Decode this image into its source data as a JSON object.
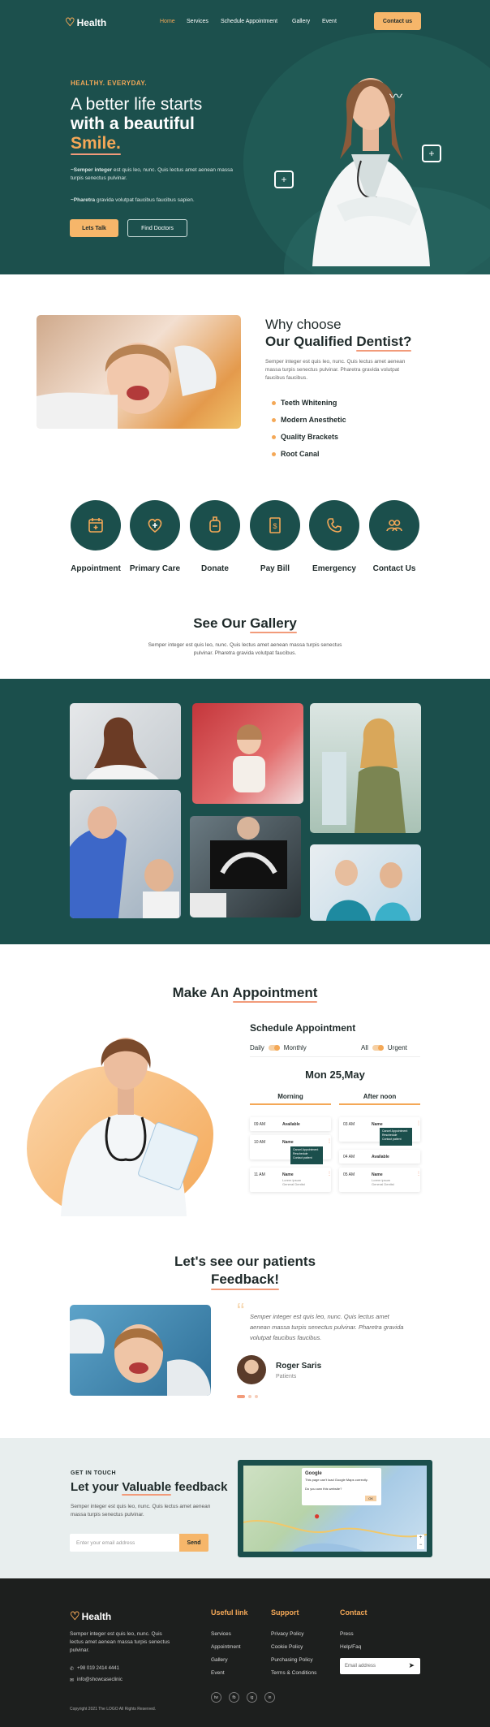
{
  "brand": {
    "name": "Health",
    "mark": "♡"
  },
  "nav": {
    "items": [
      "Home",
      "Services",
      "Schedule Appointment",
      "Gallery",
      "Event"
    ],
    "contact_label": "Contact us"
  },
  "hero": {
    "tagline": "HEALTHY. EVERYDAY.",
    "title_line1": "A better life starts",
    "title_line2": "with a beautiful",
    "title_highlight": "Smile.",
    "p1_bold": "~Semper integer",
    "p1": " est quis leo, nunc. Quis lectus amet aenean massa turpis senectus pulvinar.",
    "p2_bold": "~Pharetra",
    "p2": " gravida volutpat faucibus faucibus sapien.",
    "btn_primary": "Lets Talk",
    "btn_secondary": "Find Doctors"
  },
  "why": {
    "title_line1": "Why choose",
    "title_prefix": "Our Qualified ",
    "title_highlight": "Dentist?",
    "body": "Semper integer est quis leo, nunc. Quis lectus amet aenean massa turpis senectus pulvinar. Pharetra gravida volutpat faucibus faucibus.",
    "bullets": [
      "Teeth Whitening",
      "Modern Anesthetic",
      "Quality Brackets",
      "Root Canal"
    ]
  },
  "services": [
    "Appointment",
    "Primary Care",
    "Donate",
    "Pay Bill",
    "Emergency",
    "Contact Us"
  ],
  "gallery": {
    "title_prefix": "See Our ",
    "title_highlight": "Gallery",
    "body": "Semper integer est quis leo, nunc. Quis lectus amet aenean massa turpis senectus pulvinar. Pharetra gravida volutpat faucibus."
  },
  "appointment": {
    "title_prefix": "Make An ",
    "title_highlight": "Appointment",
    "panel_title": "Schedule Appointment",
    "toggle_daily": "Daily",
    "toggle_monthly": "Monthly",
    "toggle_all": "All",
    "toggle_urgent": "Urgent",
    "date": "Mon 25,May",
    "col_morning": "Morning",
    "col_afternoon": "After noon",
    "morning_times": [
      "09 AM",
      "10 AM",
      "11 AM"
    ],
    "afternoon_times": [
      "03 AM",
      "04 AM",
      "05 AM"
    ],
    "slot_available": "Available",
    "slot_name": "Name",
    "slot_sub": "Lorem ipsum\nGeneral Dentist",
    "popup_lines": [
      "Cancel Appointment",
      "Reschedule",
      "Contact patient"
    ]
  },
  "feedback": {
    "title_line1": "Let's see our patients",
    "title_highlight": "Feedback!",
    "quote": "Semper integer est quis leo, nunc. Quis lectus amet aenean massa turpis senectus pulvinar. Pharetra gravida volutpat faucibus faucibus.",
    "name": "Roger Saris",
    "role": "Patients"
  },
  "contact": {
    "eyebrow": "GET IN TOUCH",
    "title_prefix": "Let your ",
    "title_highlight": "Valuable",
    "title_suffix": " feedback",
    "body": "Semper integer est quis leo, nunc. Quis lectus amet aenean massa turpis senectus pulvinar.",
    "email_placeholder": "Enter your email address",
    "send_label": "Send",
    "map_popup_title": "Google",
    "map_popup_text": "This page can't load Google Maps correctly.",
    "map_popup_question": "Do you own this website?",
    "map_popup_ok": "OK"
  },
  "footer": {
    "about": "Semper integer est quis leo, nunc. Quis lectus amet aenean massa turpis senectus pulvinar.",
    "phone": "+98 019 2414 4441",
    "email": "info@showcaseclinic",
    "col1_title": "Useful link",
    "col1": [
      "Services",
      "Appointment",
      "Gallery",
      "Event"
    ],
    "col2_title": "Support",
    "col2": [
      "Privacy Policy",
      "Cookie Policy",
      "Purchasing Policy",
      "Terms & Conditions"
    ],
    "col3_title": "Contact",
    "col3": [
      "Press",
      "Help/Faq"
    ],
    "email_placeholder": "Email address",
    "socials": [
      "tw",
      "fb",
      "ig",
      "in"
    ],
    "copyright": "Copyright 2021 The LOGO All Rights Reserved."
  },
  "colors": {
    "primary": "#1b4f4c",
    "accent": "#f4a857",
    "highlight": "#f29b7a",
    "footer": "#1d1f1e"
  }
}
